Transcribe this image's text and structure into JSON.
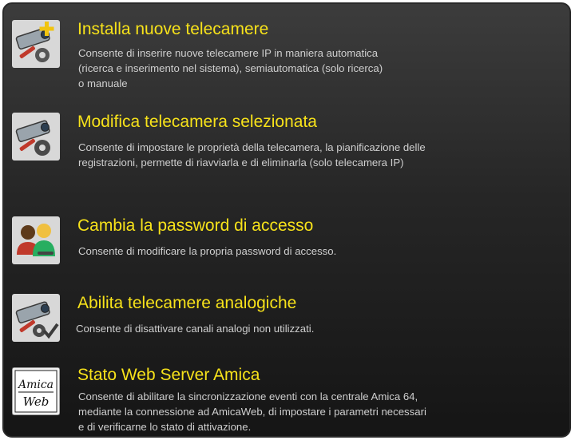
{
  "items": [
    {
      "icon": "camera-add-icon",
      "title": "Installa nuove telecamere",
      "desc": [
        "Consente di inserire nuove telecamere IP in maniera automatica",
        "(ricerca e inserimento nel sistema), semiautomatica (solo ricerca)",
        "o manuale"
      ]
    },
    {
      "icon": "camera-settings-icon",
      "title": "Modifica telecamera selezionata",
      "desc": [
        "Consente di impostare le proprietà della telecamera, la pianificazione delle",
        "registrazioni, permette di riavviarla e di eliminarla (solo telecamera IP)"
      ]
    },
    {
      "icon": "users-password-icon",
      "title": "Cambia la password di accesso",
      "desc": [
        "Consente di modificare la propria password di accesso."
      ]
    },
    {
      "icon": "camera-check-icon",
      "title": "Abilita telecamere analogiche",
      "desc": [
        "Consente di disattivare canali analogi non utilizzati."
      ]
    },
    {
      "icon": "amica-web-logo-icon",
      "logo_text": [
        "Amica",
        "Web"
      ],
      "title": "Stato Web Server Amica",
      "desc": [
        "Consente di abilitare la sincronizzazione eventi con la centrale Amica 64,",
        "mediante la connessione ad AmicaWeb, di impostare i parametri necessari",
        "e di verificarne lo stato di attivazione."
      ]
    }
  ]
}
